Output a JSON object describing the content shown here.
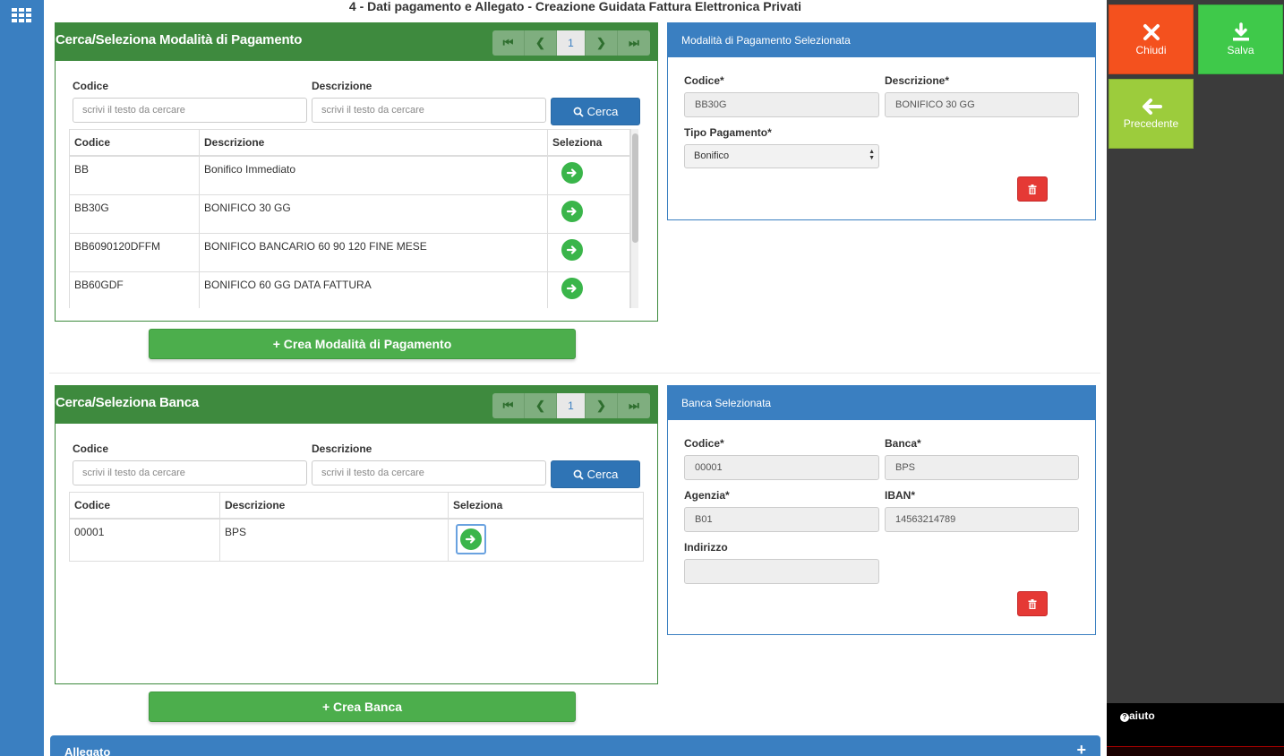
{
  "app": {
    "title": "4 - Dati pagamento e Allegato - Creazione Guidata Fattura Elettronica Privati"
  },
  "payment_search": {
    "title": "Cerca/Seleziona Modalità di Pagamento",
    "page": "1",
    "codice_label": "Codice",
    "descrizione_label": "Descrizione",
    "codice_placeholder": "scrivi il testo da cercare",
    "descrizione_placeholder": "scrivi il testo da cercare",
    "search_button": "Cerca",
    "columns": [
      "Codice",
      "Descrizione",
      "Seleziona"
    ],
    "rows": [
      {
        "codice": "BB",
        "descrizione": "Bonifico Immediato"
      },
      {
        "codice": "BB30G",
        "descrizione": "BONIFICO 30 GG"
      },
      {
        "codice": "BB6090120DFFM",
        "descrizione": "BONIFICO BANCARIO 60 90 120 FINE MESE"
      },
      {
        "codice": "BB60GDF",
        "descrizione": "BONIFICO 60 GG DATA FATTURA"
      }
    ],
    "create_button": "+ Crea Modalità di Pagamento"
  },
  "payment_selected": {
    "title": "Modalità di Pagamento Selezionata",
    "codice_label": "Codice*",
    "codice_value": "BB30G",
    "descrizione_label": "Descrizione*",
    "descrizione_value": "BONIFICO 30 GG",
    "tipo_label": "Tipo Pagamento*",
    "tipo_value": "Bonifico"
  },
  "bank_search": {
    "title": "Cerca/Seleziona Banca",
    "page": "1",
    "codice_label": "Codice",
    "descrizione_label": "Descrizione",
    "codice_placeholder": "scrivi il testo da cercare",
    "descrizione_placeholder": "scrivi il testo da cercare",
    "search_button": "Cerca",
    "columns": [
      "Codice",
      "Descrizione",
      "Seleziona"
    ],
    "rows": [
      {
        "codice": "00001",
        "descrizione": "BPS"
      }
    ],
    "create_button": "+ Crea Banca"
  },
  "bank_selected": {
    "title": "Banca Selezionata",
    "codice_label": "Codice*",
    "codice_value": "00001",
    "banca_label": "Banca*",
    "banca_value": "BPS",
    "agenzia_label": "Agenzia*",
    "agenzia_value": "B01",
    "iban_label": "IBAN*",
    "iban_value": "14563214789",
    "indirizzo_label": "Indirizzo",
    "indirizzo_value": ""
  },
  "allegato": {
    "title": "Allegato",
    "plus": "+"
  },
  "actions": {
    "chiudi": "Chiudi",
    "salva": "Salva",
    "precedente": "Precedente",
    "help": "aiuto"
  },
  "colors": {
    "primary_blue": "#3a7fc1",
    "panel_green": "#3e8a3e",
    "button_green": "#4cae4c",
    "chiudi": "#f4511e",
    "salva": "#3fc94a",
    "precedente": "#9ccc3c",
    "delete_red": "#e53935"
  }
}
